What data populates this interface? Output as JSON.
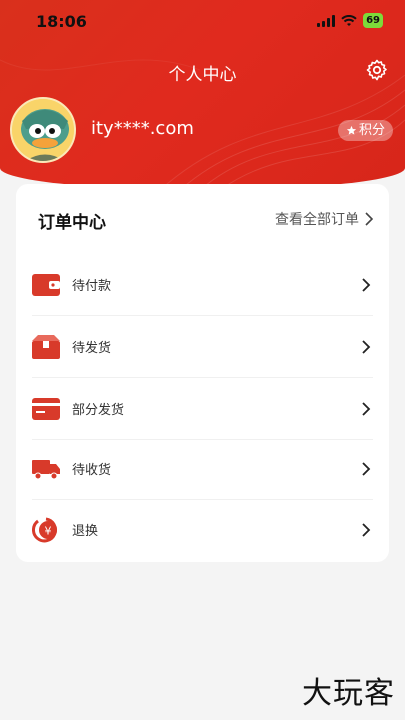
{
  "status_bar": {
    "time": "18:06",
    "battery": "69"
  },
  "header": {
    "title": "个人中心"
  },
  "profile": {
    "username": "ity****.com",
    "points_label": "积分"
  },
  "orders": {
    "title": "订单中心",
    "view_all": "查看全部订单",
    "items": [
      {
        "label": "待付款",
        "icon": "wallet-icon"
      },
      {
        "label": "待发货",
        "icon": "box-icon"
      },
      {
        "label": "部分发货",
        "icon": "card-icon"
      },
      {
        "label": "待收货",
        "icon": "truck-icon"
      },
      {
        "label": "退换",
        "icon": "refund-icon"
      }
    ]
  },
  "watermark": "大玩客",
  "colors": {
    "brand_red": "#e02a1e",
    "icon_red": "#d83a2a"
  }
}
